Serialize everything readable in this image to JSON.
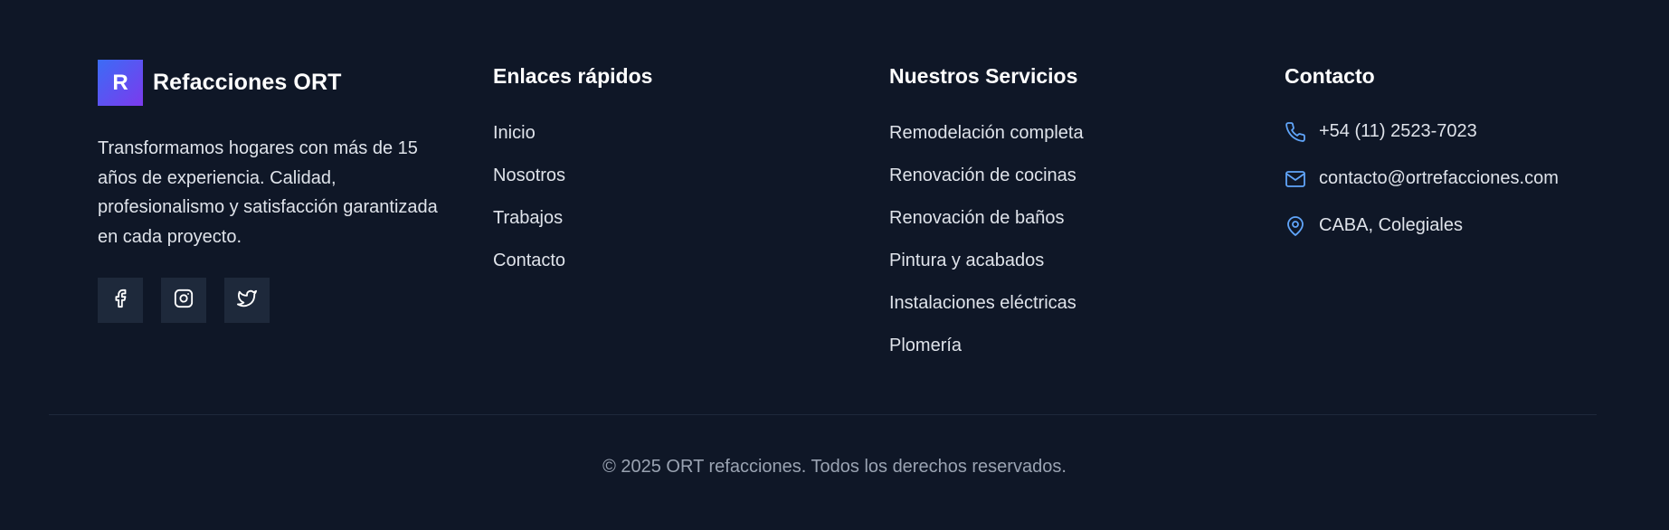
{
  "brand": {
    "logo_letter": "R",
    "name": "Refacciones ORT",
    "description": "Transformamos hogares con más de 15 años de experiencia. Calidad, profesionalismo y satisfacción garantizada en cada proyecto."
  },
  "social": [
    {
      "icon": "facebook-icon"
    },
    {
      "icon": "instagram-icon"
    },
    {
      "icon": "twitter-icon"
    }
  ],
  "quick_links": {
    "title": "Enlaces rápidos",
    "items": [
      "Inicio",
      "Nosotros",
      "Trabajos",
      "Contacto"
    ]
  },
  "services": {
    "title": "Nuestros Servicios",
    "items": [
      "Remodelación completa",
      "Renovación de cocinas",
      "Renovación de baños",
      "Pintura y acabados",
      "Instalaciones eléctricas",
      "Plomería"
    ]
  },
  "contact": {
    "title": "Contacto",
    "items": [
      {
        "icon": "phone-icon",
        "text": "+54 (11) 2523-7023"
      },
      {
        "icon": "mail-icon",
        "text": "contacto@ortrefacciones.com"
      },
      {
        "icon": "map-pin-icon",
        "text": "CABA, Colegiales"
      }
    ]
  },
  "copyright": "© 2025 ORT refacciones. Todos los derechos reservados.",
  "colors": {
    "background": "#0f1727",
    "accent": "#60a5fa",
    "logo_gradient_start": "#3b6cf6",
    "logo_gradient_end": "#7c3aed",
    "social_bg": "#1e293b"
  }
}
